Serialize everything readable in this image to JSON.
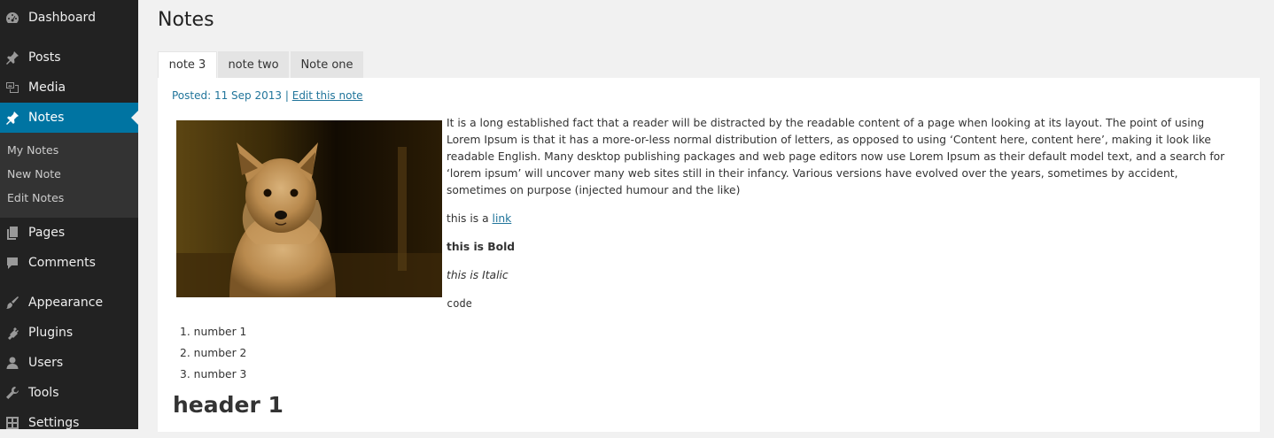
{
  "sidebar": {
    "items": [
      {
        "label": "Dashboard",
        "icon": "dashboard-icon"
      },
      {
        "label": "Posts",
        "icon": "pin-icon"
      },
      {
        "label": "Media",
        "icon": "media-icon"
      },
      {
        "label": "Notes",
        "icon": "pin-icon",
        "active": true
      },
      {
        "label": "Pages",
        "icon": "pages-icon"
      },
      {
        "label": "Comments",
        "icon": "comment-icon"
      },
      {
        "label": "Appearance",
        "icon": "brush-icon"
      },
      {
        "label": "Plugins",
        "icon": "plug-icon"
      },
      {
        "label": "Users",
        "icon": "user-icon"
      },
      {
        "label": "Tools",
        "icon": "wrench-icon"
      },
      {
        "label": "Settings",
        "icon": "settings-icon"
      }
    ],
    "submenu": [
      "My Notes",
      "New Note",
      "Edit Notes"
    ],
    "active_color": "#0074a2"
  },
  "page": {
    "title": "Notes"
  },
  "tabs": [
    "note 3",
    "note two",
    "Note one"
  ],
  "note": {
    "posted": "Posted: 11 Sep 2013",
    "separator": "|",
    "edit_link": "Edit this note",
    "body": "It is a long established fact that a reader will be distracted by the readable content of a page when looking at its layout. The point of using Lorem Ipsum is that it has a more-or-less normal distribution of letters, as opposed to using ‘Content here, content here’, making it look like readable English. Many desktop publishing packages and web page editors now use Lorem Ipsum as their default model text, and a search for ‘lorem ipsum’ will uncover many web sites still in their infancy. Various versions have evolved over the years, sometimes by accident, sometimes on purpose (injected humour and the like)",
    "link_prefix": "this is a",
    "link_text": "link",
    "bold": "this is Bold",
    "italic": "this is Italic",
    "code": "code",
    "list": [
      "number 1",
      "number 2",
      "number 3"
    ],
    "list_markers": [
      "1.",
      "2.",
      "3."
    ],
    "header": "header 1"
  }
}
